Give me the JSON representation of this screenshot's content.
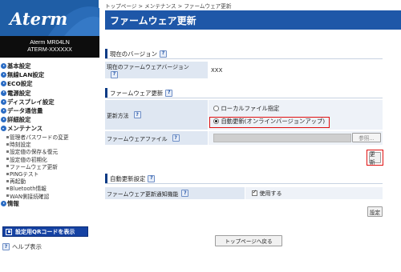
{
  "sidebar": {
    "logo": "Aterm",
    "model": "Aterm MR04LN",
    "device_id": "ATERM-XXXXXX",
    "menu": [
      {
        "label": "基本設定",
        "open": false
      },
      {
        "label": "無線LAN設定",
        "open": false
      },
      {
        "label": "ECO設定",
        "open": false
      },
      {
        "label": "電源設定",
        "open": false
      },
      {
        "label": "ディスプレイ設定",
        "open": false
      },
      {
        "label": "データ通信量",
        "open": false
      },
      {
        "label": "詳細設定",
        "open": false
      },
      {
        "label": "メンテナンス",
        "open": true
      }
    ],
    "maintenance_items": [
      "管理者パスワードの変更",
      "時刻設定",
      "設定値の保存＆復元",
      "設定値の初期化",
      "ファームウェア更新",
      "PINGテスト",
      "再起動",
      "Bluetooth情報",
      "WAN側接続確認"
    ],
    "info_label": "情報",
    "qr_button": "設定用QRコードを表示",
    "help_label": "ヘルプ表示"
  },
  "breadcrumb": {
    "top": "トップページ",
    "sep1": " > ",
    "maintenance": "メンテナンス",
    "sep2": " > ",
    "current": "ファームウェア更新"
  },
  "page_title": "ファームウェア更新",
  "current_version": {
    "section_title": "現在のバージョン",
    "row_label": "現在のファームウェアバージョン",
    "row_value": "XXX"
  },
  "firmware_update": {
    "section_title": "ファームウェア更新",
    "method_label": "更新方法",
    "option_local": "ローカルファイル指定",
    "option_auto": "自動更新(オンラインバージョンアップ)",
    "selected": "auto",
    "file_label": "ファームウェアファイル",
    "browse_button": "参照...",
    "update_button": "更新"
  },
  "auto_update": {
    "section_title": "自動更新設定",
    "notify_label": "ファームウェア更新通知機能",
    "use_label": "使用する",
    "use_checked": true,
    "settings_button": "設定"
  },
  "back_button": "トップページへ戻る",
  "colors": {
    "title_bar": "#1e57a8",
    "logo_bg": "#1f5ea6",
    "qr_button": "#1542a3",
    "highlight": "#e01010"
  }
}
